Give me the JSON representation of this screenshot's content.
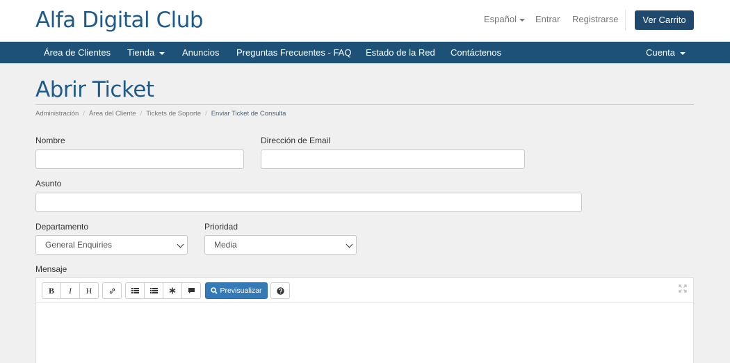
{
  "header": {
    "brand": "Alfa Digital Club",
    "language": "Español",
    "login": "Entrar",
    "register": "Registrarse",
    "cart_button": "Ver Carrito"
  },
  "nav": {
    "items": [
      {
        "label": "Área de Clientes"
      },
      {
        "label": "Tienda"
      },
      {
        "label": "Anuncios"
      },
      {
        "label": "Preguntas Frecuentes - FAQ"
      },
      {
        "label": "Estado de la Red"
      },
      {
        "label": "Contáctenos"
      }
    ],
    "account": "Cuenta"
  },
  "page": {
    "title": "Abrir Ticket",
    "breadcrumb": [
      "Administración",
      "Área del Cliente",
      "Tickets de Soporte",
      "Enviar Ticket de Consulta"
    ]
  },
  "form": {
    "name_label": "Nombre",
    "name_value": "",
    "email_label": "Dirección de Email",
    "email_value": "",
    "subject_label": "Asunto",
    "subject_value": "",
    "department_label": "Departamento",
    "department_value": "General Enquiries",
    "priority_label": "Prioridad",
    "priority_value": "Media",
    "message_label": "Mensaje"
  },
  "editor": {
    "bold": "B",
    "italic": "I",
    "heading": "H",
    "preview": "Previsualizar"
  },
  "colors": {
    "brand": "#1f5a8a",
    "navbar": "#1d5177",
    "cart_button": "#1f4a6e",
    "preview_button": "#337ab7"
  }
}
